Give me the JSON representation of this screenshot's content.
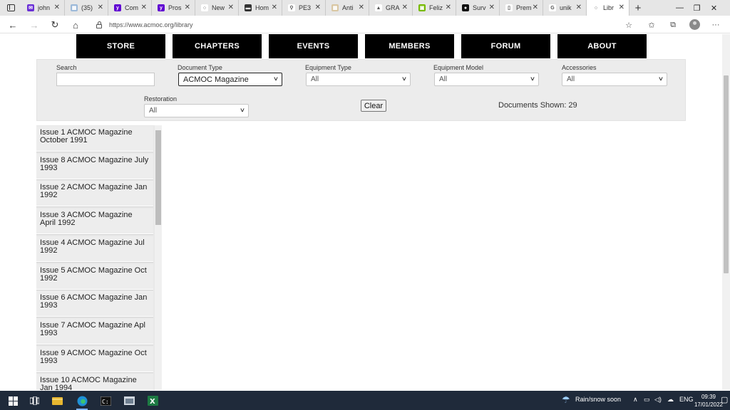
{
  "browser": {
    "tabs": [
      {
        "title": "john",
        "color": "#6a2fd6",
        "glyph": "✉"
      },
      {
        "title": "(35)",
        "color": "#9cb9d9",
        "glyph": "▦"
      },
      {
        "title": "Com",
        "color": "#6001d2",
        "glyph": "y"
      },
      {
        "title": "Pros",
        "color": "#6001d2",
        "glyph": "y"
      },
      {
        "title": "New",
        "color": "#ffffff",
        "glyph": "○"
      },
      {
        "title": "Hom",
        "color": "#333333",
        "glyph": "▬"
      },
      {
        "title": "PE3",
        "color": "#ffffff",
        "glyph": "⚲"
      },
      {
        "title": "Anti",
        "color": "#d9c7a3",
        "glyph": "▦"
      },
      {
        "title": "GRA",
        "color": "#ffffff",
        "glyph": "▲"
      },
      {
        "title": "Feliz",
        "color": "#76b900",
        "glyph": "▣"
      },
      {
        "title": "Surv",
        "color": "#111111",
        "glyph": "●"
      },
      {
        "title": "Prem",
        "color": "#ffffff",
        "glyph": "▯"
      },
      {
        "title": "unik",
        "color": "#ffffff",
        "glyph": "G"
      },
      {
        "title": "Libr",
        "color": "#ffffff",
        "glyph": "○",
        "active": true
      }
    ],
    "url": "https://www.acmoc.org/library"
  },
  "nav": {
    "items": [
      "STORE",
      "CHAPTERS",
      "EVENTS",
      "MEMBERS",
      "FORUM",
      "ABOUT"
    ]
  },
  "filters": {
    "search_label": "Search",
    "search_value": "",
    "document_type": {
      "label": "Document Type",
      "value": "ACMOC Magazine"
    },
    "equipment_type": {
      "label": "Equipment Type",
      "value": "All"
    },
    "equipment_model": {
      "label": "Equipment Model",
      "value": "All"
    },
    "accessories": {
      "label": "Accessories",
      "value": "All"
    },
    "restoration": {
      "label": "Restoration",
      "value": "All"
    },
    "clear_label": "Clear",
    "documents_shown": "Documents Shown: 29"
  },
  "documents": [
    "Issue 1 ACMOC Magazine October 1991",
    "Issue 8 ACMOC Magazine July 1993",
    "Issue 2 ACMOC Magazine Jan 1992",
    "Issue 3 ACMOC Magazine April 1992",
    "Issue 4 ACMOC Magazine Jul 1992",
    "Issue 5 ACMOC Magazine Oct 1992",
    "Issue 6 ACMOC Magazine Jan 1993",
    "Issue 7 ACMOC Magazine Apl 1993",
    "Issue 9 ACMOC Magazine Oct 1993",
    "Issue 10 ACMOC Magazine Jan 1994"
  ],
  "taskbar": {
    "weather": "Rain/snow soon",
    "language": "ENG",
    "time": "09:39",
    "date": "17/01/2022"
  }
}
